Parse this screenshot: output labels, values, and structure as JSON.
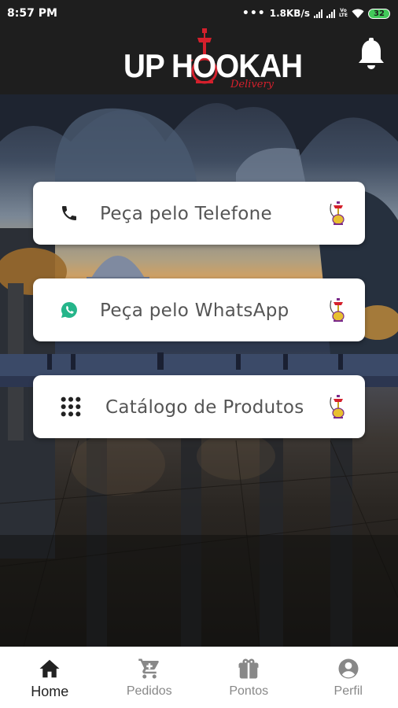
{
  "status_bar": {
    "time": "8:57 PM",
    "dots": "•••",
    "speed": "1.8KB/s",
    "network_label_top": "Vo",
    "network_label_bottom": "LTE",
    "battery": "32"
  },
  "header": {
    "logo_text": "UP HOOKAH",
    "logo_subtext": "Delivery",
    "bell_icon": "bell-icon"
  },
  "actions": [
    {
      "label": "Peça pelo Telefone",
      "icon": "phone-icon"
    },
    {
      "label": "Peça pelo WhatsApp",
      "icon": "whatsapp-icon"
    },
    {
      "label": "Catálogo de Produtos",
      "icon": "grid-icon"
    }
  ],
  "bottom_nav": {
    "items": [
      {
        "label": "Home",
        "icon": "home-icon",
        "active": true
      },
      {
        "label": "Pedidos",
        "icon": "cart-icon",
        "active": false
      },
      {
        "label": "Pontos",
        "icon": "gift-icon",
        "active": false
      },
      {
        "label": "Perfil",
        "icon": "account-circle-icon",
        "active": false
      }
    ]
  },
  "colors": {
    "brand_red": "#d4202c",
    "whatsapp_green": "#25b58a",
    "header_bg": "#1e1e1e",
    "active_nav": "#222222",
    "inactive_nav": "#888888"
  }
}
